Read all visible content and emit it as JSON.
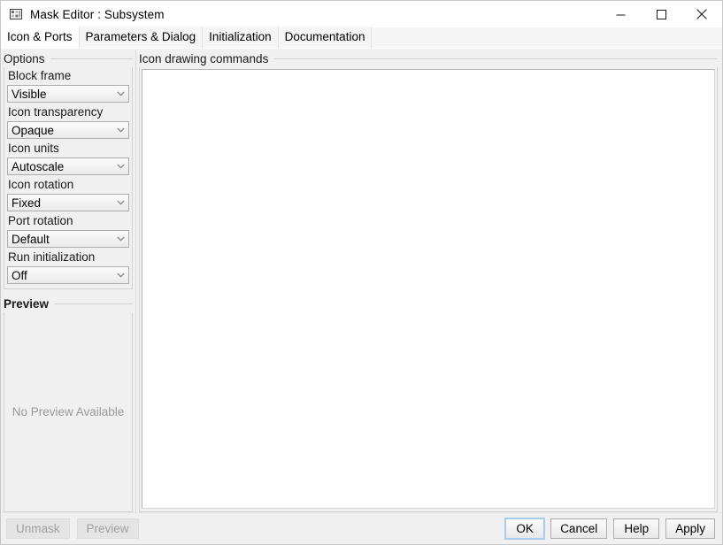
{
  "window": {
    "title": "Mask Editor : Subsystem",
    "icon": "mask-editor-icon",
    "controls": {
      "minimize": "minimize-icon",
      "maximize": "maximize-icon",
      "close": "close-icon"
    }
  },
  "tabs": [
    {
      "label": "Icon & Ports",
      "selected": true
    },
    {
      "label": "Parameters & Dialog",
      "selected": false
    },
    {
      "label": "Initialization",
      "selected": false
    },
    {
      "label": "Documentation",
      "selected": false
    }
  ],
  "left_pane": {
    "options_group": {
      "title": "Options",
      "fields": [
        {
          "label": "Block frame",
          "value": "Visible"
        },
        {
          "label": "Icon transparency",
          "value": "Opaque"
        },
        {
          "label": "Icon units",
          "value": "Autoscale"
        },
        {
          "label": "Icon rotation",
          "value": "Fixed"
        },
        {
          "label": "Port rotation",
          "value": "Default"
        },
        {
          "label": "Run initialization",
          "value": "Off"
        }
      ]
    },
    "preview_group": {
      "title": "Preview",
      "empty_text": "No Preview Available"
    }
  },
  "right_pane": {
    "group_title": "Icon drawing commands",
    "editor_value": ""
  },
  "bottom_bar": {
    "unmask_label": "Unmask",
    "preview_label": "Preview",
    "ok_label": "OK",
    "cancel_label": "Cancel",
    "help_label": "Help",
    "apply_label": "Apply"
  },
  "colors": {
    "window_bg": "#f0f0f0",
    "titlebar_bg": "#ffffff",
    "tab_selected_bg": "#ffffff",
    "editor_bg": "#ffffff",
    "focus_ring": "#a6cdee",
    "disabled_text": "#a0a0a0",
    "placeholder_text": "#9a9a9a"
  }
}
